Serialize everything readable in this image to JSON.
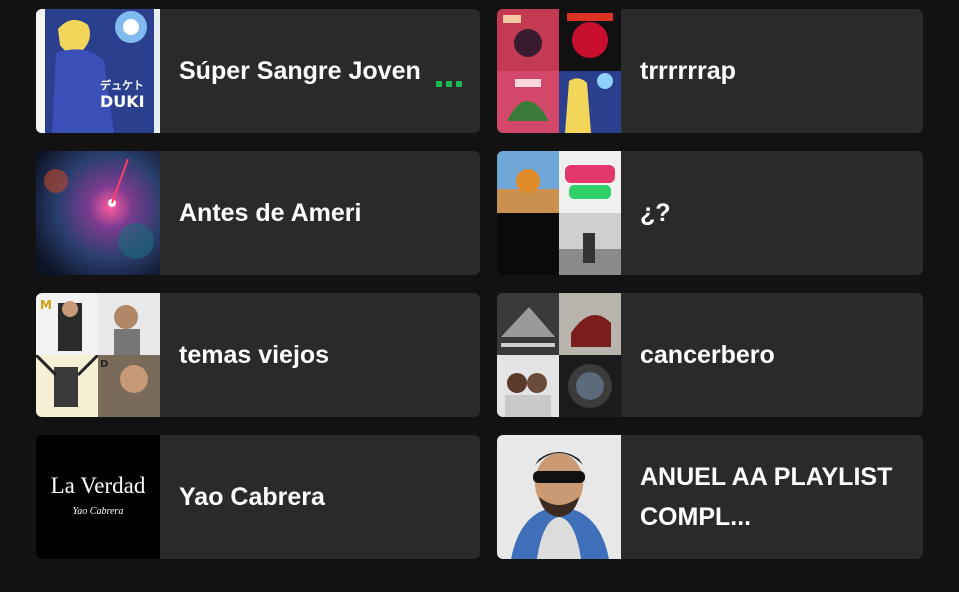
{
  "playlists": [
    {
      "name": "Súper Sangre Joven",
      "cover_text": "デュケト DUKI",
      "playing": true
    },
    {
      "name": "trrrrrrap"
    },
    {
      "name": "Antes de Ameri"
    },
    {
      "name": "¿?"
    },
    {
      "name": "temas viejos"
    },
    {
      "name": "cancerbero"
    },
    {
      "name": "Yao Cabrera",
      "cover_title": "La Verdad",
      "cover_subtitle": "Yao Cabrera"
    },
    {
      "name": "ANUEL AA PLAYLIST COMPL..."
    }
  ],
  "colors": {
    "background": "#121212",
    "card": "#2a2a2a",
    "accent": "#1db954",
    "text": "#ffffff"
  }
}
